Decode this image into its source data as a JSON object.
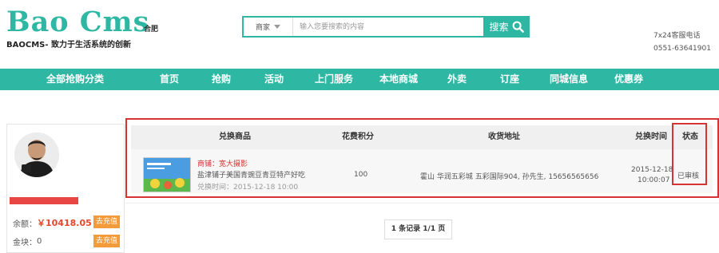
{
  "header": {
    "logo_title": "Bao Cms",
    "logo_subtitle": "BAOCMS- 致力于生活系统的创新",
    "city": "合肥",
    "search": {
      "type_selected": "商家",
      "placeholder": "输入您要搜索的内容",
      "button_label": "搜索"
    },
    "service_label": "7x24客服电话",
    "phone": "0551-63641901"
  },
  "nav": {
    "items": [
      {
        "label": "全部抢购分类"
      },
      {
        "label": "首页"
      },
      {
        "label": "抢购"
      },
      {
        "label": "活动"
      },
      {
        "label": "上门服务"
      },
      {
        "label": "本地商城"
      },
      {
        "label": "外卖"
      },
      {
        "label": "订座"
      },
      {
        "label": "同城信息"
      },
      {
        "label": "优惠券"
      }
    ]
  },
  "sidebar": {
    "balance_label": "余额：",
    "balance_value": "￥10418.05",
    "recharge_label": "去充值",
    "gold_label": "金块：",
    "gold_value": "0",
    "gold_recharge_label": "去充值"
  },
  "table": {
    "columns": [
      "兑换商品",
      "花费积分",
      "收货地址",
      "兑换时间",
      "状态"
    ],
    "rows": [
      {
        "shop": "商铺：宽大摄影",
        "product": "盐津铺子美国青豌豆青豆特产好吃",
        "exchange_time_label": "兑换时间：2015-12-18 10:00",
        "points": "100",
        "address": "霍山 华润五彩城 五彩国际904, 孙先生, 15656565656",
        "time_date": "2015-12-18",
        "time_clock": "10:00:07",
        "status": "已审核"
      }
    ]
  },
  "pager": {
    "text": "1 条记录 1/1 页"
  },
  "colors": {
    "brand": "#2eb8a4",
    "accent_red": "#d63333",
    "recharge_orange": "#f39a3b"
  }
}
